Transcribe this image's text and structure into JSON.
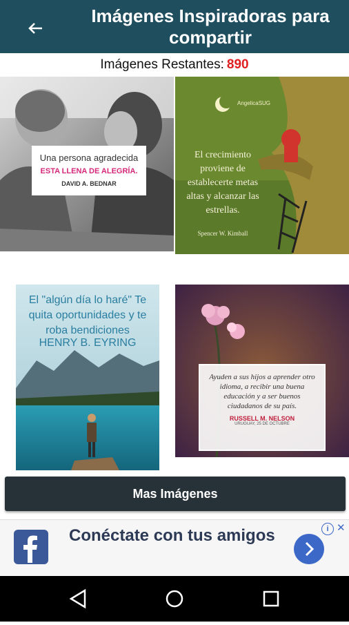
{
  "header": {
    "title": "Imágenes Inspiradoras para compartir",
    "back_icon": "arrow-left-icon"
  },
  "counter": {
    "label": "Imágenes Restantes:",
    "value": "890",
    "value_color": "#e02020"
  },
  "images": [
    {
      "quote": "Una persona agradecida",
      "highlight": "ESTA LLENA DE ALEGRÍA.",
      "author": "DAVID A. BEDNAR"
    },
    {
      "quote": "El crecimiento proviene de establecerte metas altas y alcanzar las estrellas.",
      "author": "Spencer W. Kimball",
      "signature": "AngelicaSUG"
    },
    {
      "quote": "El \"algún día lo haré\" Te quita oportunidades y te roba bendiciones",
      "author": "HENRY B. EYRING"
    },
    {
      "quote": "Ayuden a sus hijos a aprender otro idioma, a recibir una buena educación y a ser buenos ciudadanos de su país.",
      "author": "RUSSELL M. NELSON",
      "date": "URUGUAY, 25 DE OCTUBRE"
    }
  ],
  "more_button": {
    "label": "Mas Imágenes"
  },
  "ad": {
    "text": "Conéctate con tus amigos",
    "info_icon": "info-icon",
    "close_icon": "close-icon",
    "next_icon": "chevron-right-icon",
    "brand_color": "#3b5998"
  },
  "nav": {
    "back": "nav-back-icon",
    "home": "nav-home-icon",
    "recents": "nav-recents-icon"
  }
}
